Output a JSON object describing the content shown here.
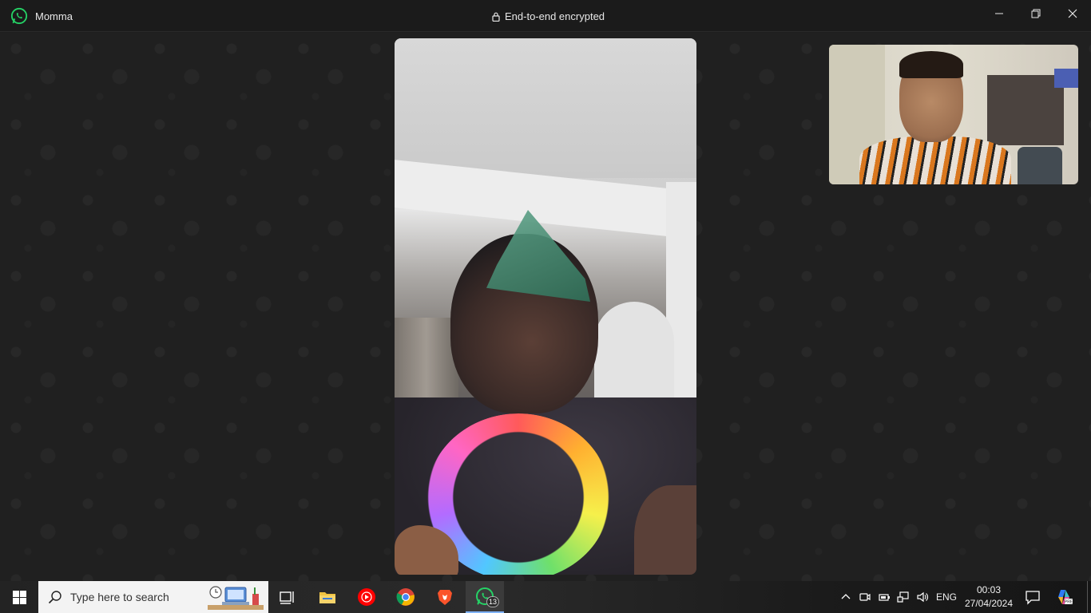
{
  "window": {
    "contact_name": "Momma",
    "encryption_label": "End-to-end encrypted",
    "app_icon": "whatsapp-icon",
    "controls": [
      "minimize-icon",
      "maximize-icon",
      "close-icon"
    ]
  },
  "call": {
    "remote_video": "remote-participant-video",
    "self_video": "self-view-video"
  },
  "taskbar": {
    "start_icon": "windows-start-icon",
    "search_placeholder": "Type here to search",
    "pinned_apps": [
      {
        "name": "task-view",
        "icon": "task-view-icon"
      },
      {
        "name": "file-explorer",
        "icon": "folder-icon"
      },
      {
        "name": "youtube-music",
        "icon": "youtube-music-icon"
      },
      {
        "name": "chrome",
        "icon": "chrome-icon"
      },
      {
        "name": "brave",
        "icon": "brave-icon"
      },
      {
        "name": "whatsapp",
        "icon": "whatsapp-icon",
        "badge": "13",
        "active": true
      }
    ],
    "tray": {
      "language": "ENG",
      "time": "00:03",
      "date": "27/04/2024"
    }
  },
  "colors": {
    "whatsapp_green": "#25d366",
    "titlebar_bg": "#1b1b1b",
    "call_bg": "#202020",
    "taskbar_active_underline": "#7fb3ff"
  }
}
